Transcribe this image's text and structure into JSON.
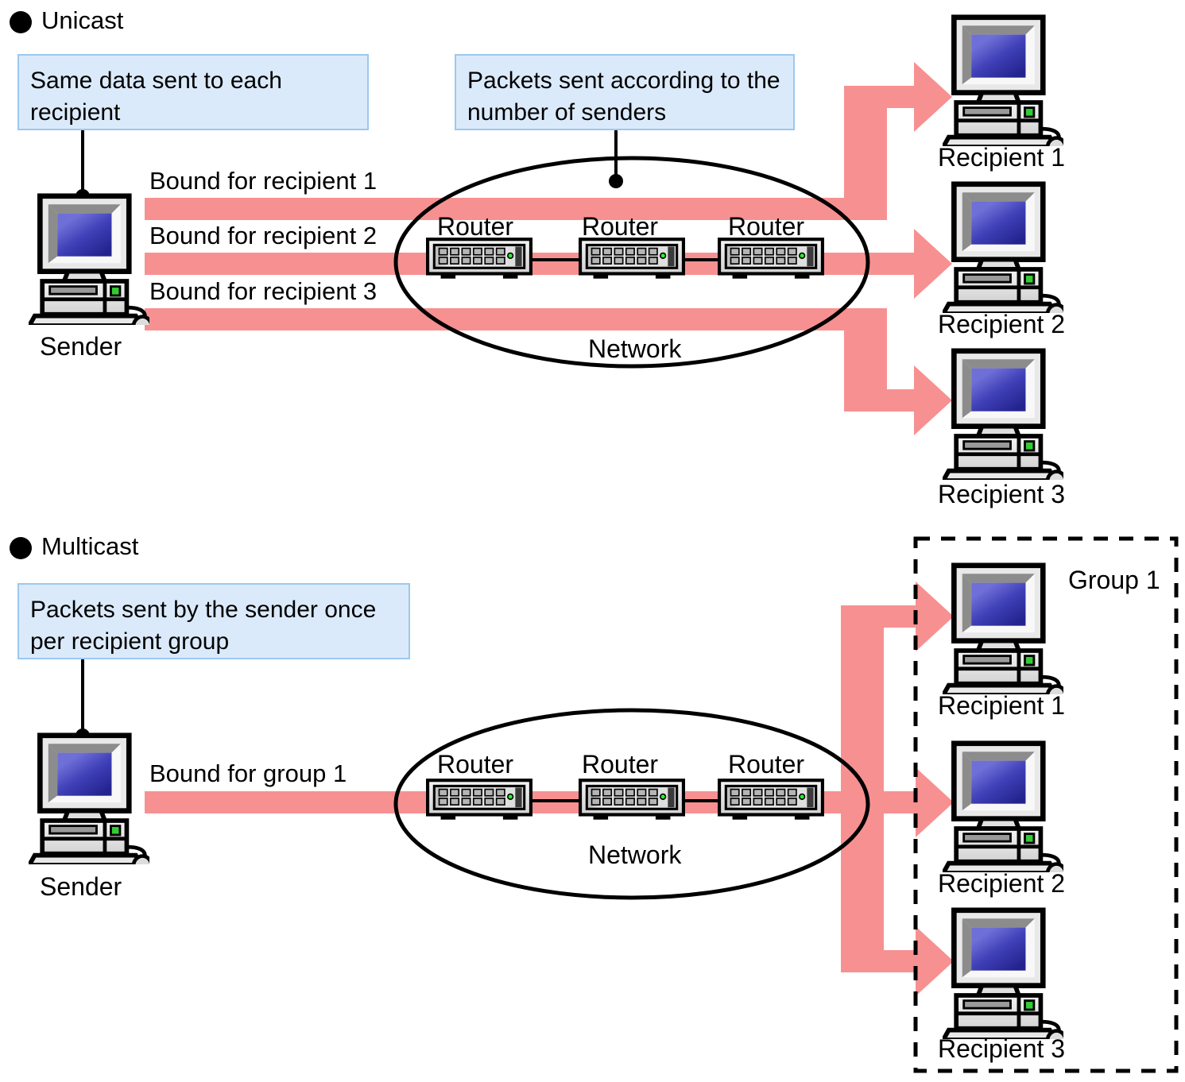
{
  "diagram": {
    "title_unicast": "Unicast",
    "title_multicast": "Multicast",
    "colors": {
      "arrow_pink": "#F79191",
      "callout_fill": "#DBEAFA",
      "callout_border": "#9CC8EE",
      "screen_blue": "#3333AA",
      "chassis_grey": "#E3E3E3",
      "outline_black": "#000000",
      "led_green": "#33CC33"
    },
    "sections": [
      {
        "id": "unicast",
        "heading": "Unicast",
        "callouts": [
          {
            "id": "same-data",
            "text": "Same data sent to each recipient"
          },
          {
            "id": "packets-per-sender",
            "text": "Packets sent according to the number of senders"
          }
        ],
        "sender": {
          "label": "Sender"
        },
        "flows": [
          {
            "label": "Bound for recipient 1"
          },
          {
            "label": "Bound for recipient 2"
          },
          {
            "label": "Bound for recipient 3"
          }
        ],
        "network": {
          "label": "Network",
          "routers": [
            {
              "label": "Router"
            },
            {
              "label": "Router"
            },
            {
              "label": "Router"
            }
          ]
        },
        "recipients": [
          {
            "label": "Recipient 1"
          },
          {
            "label": "Recipient 2"
          },
          {
            "label": "Recipient 3"
          }
        ],
        "group": null
      },
      {
        "id": "multicast",
        "heading": "Multicast",
        "callouts": [
          {
            "id": "packets-per-group",
            "text": "Packets sent by the sender once per recipient group"
          }
        ],
        "sender": {
          "label": "Sender"
        },
        "flows": [
          {
            "label": "Bound for group 1"
          }
        ],
        "network": {
          "label": "Network",
          "routers": [
            {
              "label": "Router"
            },
            {
              "label": "Router"
            },
            {
              "label": "Router"
            }
          ]
        },
        "recipients": [
          {
            "label": "Recipient 1"
          },
          {
            "label": "Recipient 2"
          },
          {
            "label": "Recipient 3"
          }
        ],
        "group": {
          "label": "Group 1"
        }
      }
    ],
    "icons": {
      "sender_icon": "desktop-computer-icon",
      "recipient_icon": "desktop-computer-icon",
      "router_icon": "router-device-icon",
      "network_icon": "network-cloud-ellipse-icon",
      "flow_icon": "pink-arrow-icon",
      "group_icon": "dashed-group-box-icon",
      "bullet_icon": "filled-circle-bullet-icon"
    }
  }
}
